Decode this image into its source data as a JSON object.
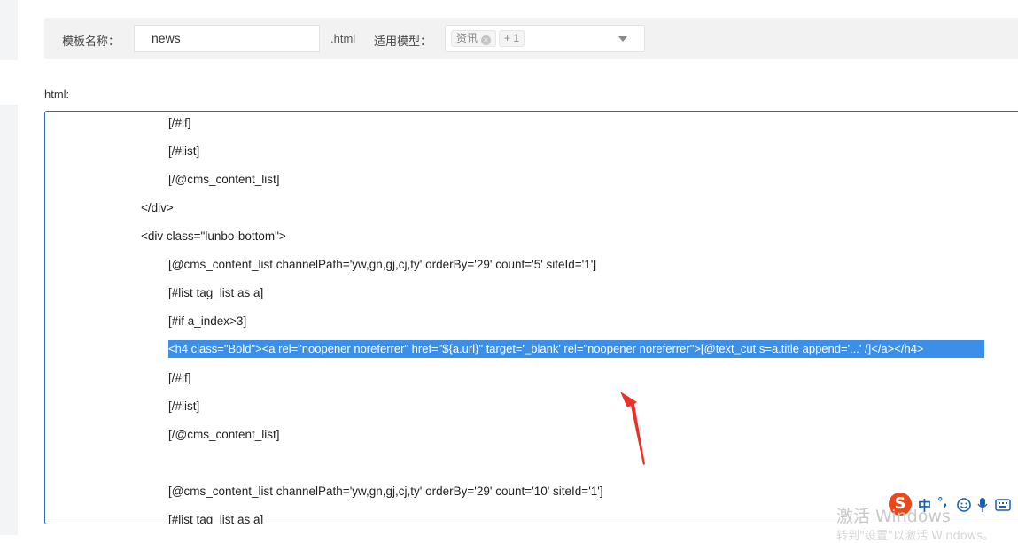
{
  "form": {
    "name_label": "模板名称：",
    "name_value": "news",
    "extension": ".html",
    "model_label": "适用模型：",
    "model_tags": [
      "资讯",
      "+ 1"
    ],
    "tag_close": "×"
  },
  "editor": {
    "label": "html:",
    "lines": [
      {
        "text": "[/#if]"
      },
      {
        "text": "[/#list]"
      },
      {
        "text": "[/@cms_content_list]"
      },
      {
        "text": "</div>"
      },
      {
        "text": "<div class=\"lunbo-bottom\">"
      },
      {
        "text": "[@cms_content_list channelPath='yw,gn,gj,cj,ty' orderBy='29' count='5' siteId='1']"
      },
      {
        "text": "[#list tag_list as a]"
      },
      {
        "text": "[#if a_index>3]"
      },
      {
        "text": "<h4 class=\"Bold\"><a rel=\"noopener noreferrer\" href=\"${a.url}\" target='_blank' rel=\"noopener noreferrer\">[@text_cut s=a.title append='...' /]</a></h4>"
      },
      {
        "text": "[/#if]"
      },
      {
        "text": "[/#list]"
      },
      {
        "text": "[/@cms_content_list]"
      },
      {
        "text": ""
      },
      {
        "text": "[@cms_content_list channelPath='yw,gn,gj,cj,ty' orderBy='29' count='10' siteId='1']"
      },
      {
        "text": "[#list tag_list as a]"
      }
    ]
  },
  "taskbar": {
    "ime_logo": "S",
    "ime_lang": "中",
    "ime_punct": "°,"
  },
  "watermark": {
    "line1": "激活 Windows",
    "line2": "转到\"设置\"以激活 Windows。"
  },
  "colors": {
    "selection": "#3b8fe8",
    "arrow": "#e8332a",
    "editor_border": "#3a6aa0",
    "ime_logo": "#e8481a"
  }
}
